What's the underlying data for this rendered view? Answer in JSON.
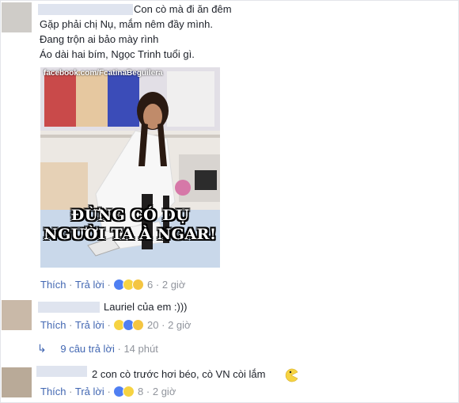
{
  "comment1": {
    "lines": [
      "Con cò mà đi ăn đêm",
      "Gặp phải chị Nụ, mắm nêm đầy mình.",
      "Đang trộn ai bảo mày rình",
      "Áo dài hai bím, Ngọc Trinh tuổi gì."
    ],
    "photo": {
      "watermark": "facebook.com/FcatinaBeguilera",
      "caption_line1": "ĐỪNG CÓ DỤ",
      "caption_line2": "NGƯỜI TA À NGAR!"
    },
    "actions": {
      "like": "Thích",
      "sep": "·",
      "reply": "Trả lời",
      "reaction_count": "6",
      "time": "2 giờ"
    }
  },
  "comment2": {
    "text": "Lauriel của em :)))",
    "actions": {
      "like": "Thích",
      "sep": "·",
      "reply": "Trả lời",
      "reaction_count": "20",
      "time": "2 giờ"
    }
  },
  "replies_link": {
    "label": "9 câu trả lời",
    "sep": "·",
    "time": "14 phút"
  },
  "comment3": {
    "text": "2 con cò trước hơi béo, cò VN còi lắm",
    "actions": {
      "like": "Thích",
      "sep": "·",
      "reply": "Trả lời",
      "reaction_count": "8",
      "time": "2 giờ"
    }
  },
  "colors": {
    "link": "#4267b2",
    "meta": "#90949c",
    "text": "#1d2129"
  }
}
